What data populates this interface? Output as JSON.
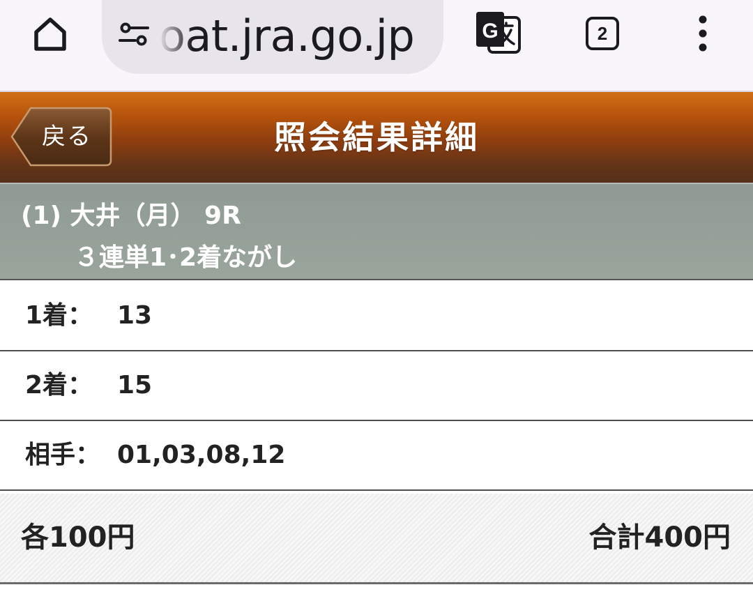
{
  "browser": {
    "url": "oat.jra.go.jp",
    "tab_count": "2"
  },
  "header": {
    "back_label": "戻る",
    "title": "照会結果詳細"
  },
  "race": {
    "line1": "(1) 大井（月） 9R",
    "line2": "３連単1･2着ながし"
  },
  "rows": [
    {
      "label": "1着：",
      "value": "13"
    },
    {
      "label": "2着：",
      "value": "15"
    },
    {
      "label": "相手：",
      "value": "01,03,08,12"
    }
  ],
  "amount": {
    "each": "各100円",
    "total": "合計400円"
  }
}
